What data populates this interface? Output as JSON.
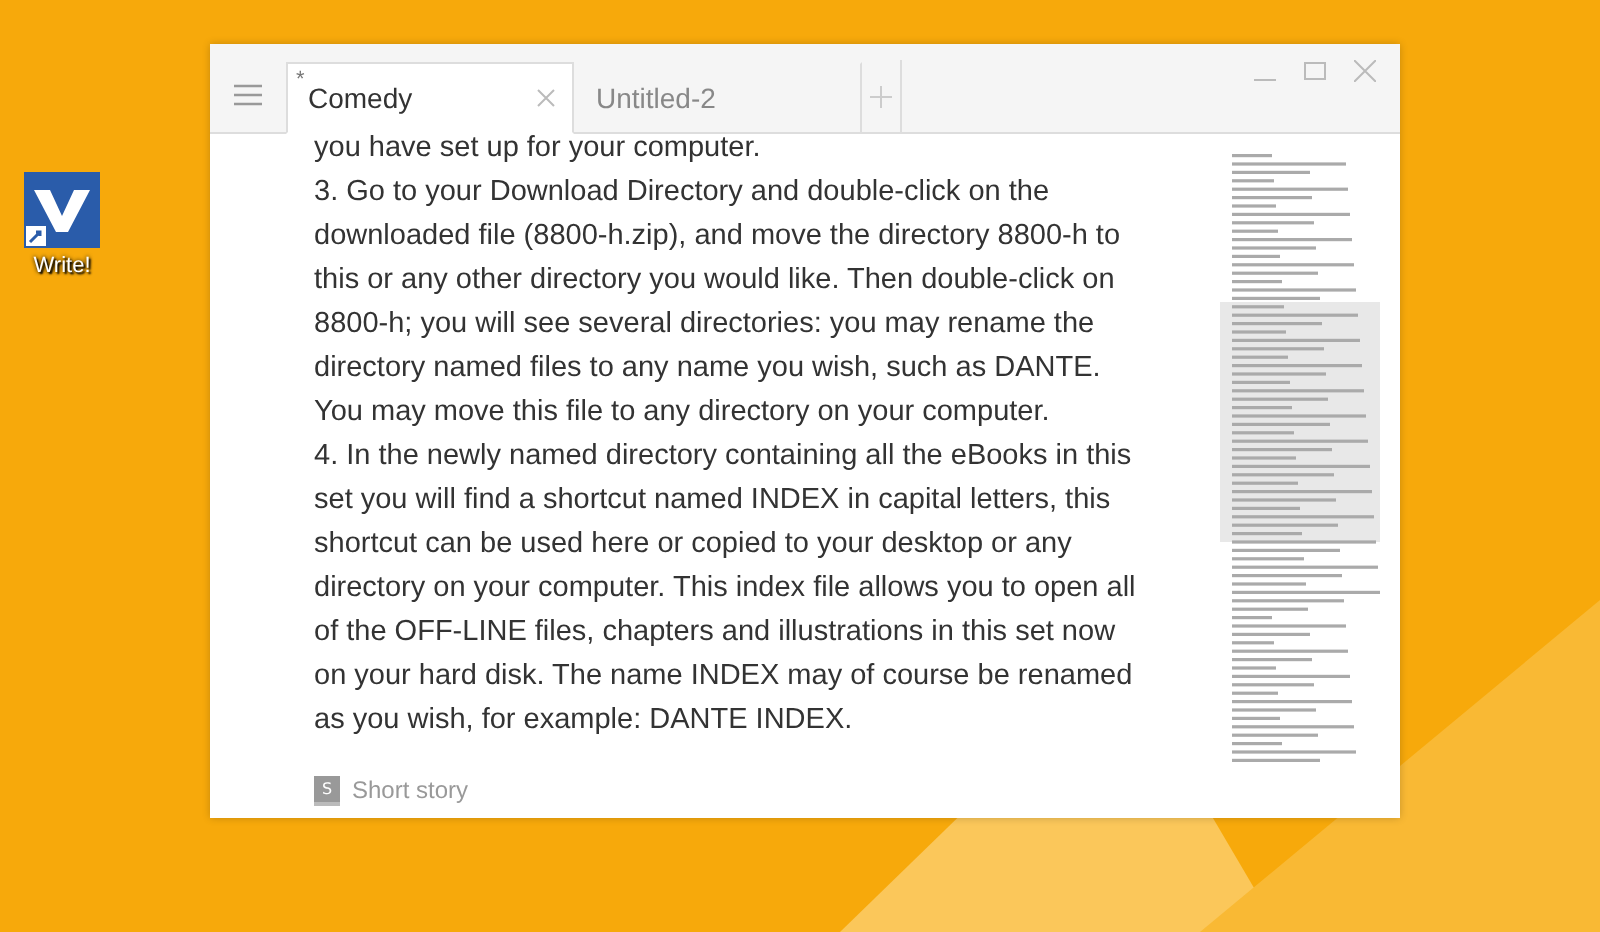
{
  "desktop_icons": [
    {
      "label": "Write!"
    }
  ],
  "window": {
    "tabs": [
      {
        "label": "Comedy",
        "marker": "*",
        "selected": true
      },
      {
        "label": "Untitled-2",
        "selected": false
      }
    ]
  },
  "editor": {
    "paragraphs": [
      "you have set up for your computer.",
      "3. Go to your Download Directory and double-click on the downloaded file (8800-h.zip), and move the directory 8800-h to this or any other directory you would like. Then double-click on 8800-h; you will see several directories: you may rename the directory named files to any name you wish, such as DANTE. You may move this file to any directory on your computer.",
      "4. In the newly named directory containing all the eBooks in this set you will find a shortcut named INDEX in capital letters, this shortcut can be used here or copied to your desktop or any directory on your computer. This index file allows you to open all of the OFF-LINE files, chapters and illustrations in this set now on your hard disk. The name INDEX may of course be renamed as you wish, for example: DANTE INDEX."
    ]
  },
  "status_bar": {
    "badge": "S",
    "label": "Short story"
  }
}
